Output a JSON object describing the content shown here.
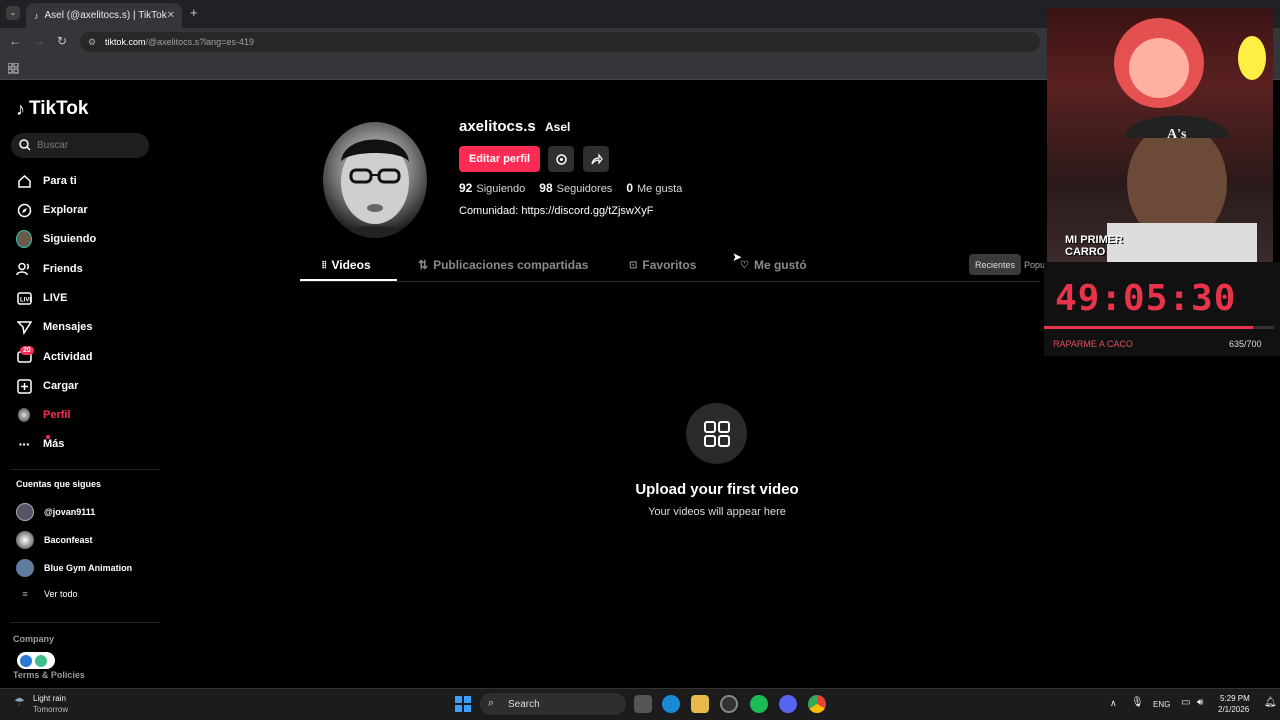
{
  "browser": {
    "tab_title": "Asel (@axelitocs.s) | TikTok",
    "url_host": "tiktok.com",
    "url_path": "/@axelitocs.s?lang=es-419"
  },
  "sidebar": {
    "logo": "TikTok",
    "search_placeholder": "Buscar",
    "items": [
      {
        "label": "Para ti",
        "icon": "home-icon"
      },
      {
        "label": "Explorar",
        "icon": "compass-icon"
      },
      {
        "label": "Siguiendo",
        "icon": "following-avatar-icon"
      },
      {
        "label": "Friends",
        "icon": "friends-icon"
      },
      {
        "label": "LIVE",
        "icon": "live-icon"
      },
      {
        "label": "Mensajes",
        "icon": "send-icon"
      },
      {
        "label": "Actividad",
        "icon": "activity-icon"
      },
      {
        "label": "Cargar",
        "icon": "upload-icon"
      },
      {
        "label": "Perfil",
        "icon": "profile-avatar-icon"
      },
      {
        "label": "Más",
        "icon": "more-icon"
      }
    ],
    "activity_badge": "20",
    "following_title": "Cuentas que sigues",
    "following": [
      "@jovan9111",
      "Baconfeast",
      "Blue Gym Animation"
    ],
    "see_all": "Ver todo",
    "company": "Company",
    "terms": "Terms & Policies"
  },
  "profile": {
    "username": "axelitocs.s",
    "nickname": "Asel",
    "edit_button": "Editar perfil",
    "following_count": "92",
    "following_label": "Siguiendo",
    "followers_count": "98",
    "followers_label": "Seguidores",
    "likes_count": "0",
    "likes_label": "Me gusta",
    "bio": "Comunidad: https://discord.gg/tZjswXyF"
  },
  "tabs": [
    "Videos",
    "Publicaciones compartidas",
    "Favoritos",
    "Me gustó"
  ],
  "sort": {
    "recent": "Recientes",
    "popular": "Populares"
  },
  "empty_state": {
    "title": "Upload your first video",
    "subtitle": "Your videos will appear here"
  },
  "stream_overlay": {
    "caption": "MI PRIMER CARRO",
    "timer": "49:05:30",
    "label": "RAPARME A CACO",
    "count": "635/700",
    "progress": 0.907,
    "accent": "#e8344a"
  },
  "taskbar": {
    "weather_line1": "Light rain",
    "weather_line2": "Tomorrow",
    "search": "Search",
    "lang": "ENG",
    "time": "5:29 PM",
    "date": "2/1/2026"
  },
  "colors": {
    "brand": "#fe2c55",
    "background": "#000000"
  }
}
